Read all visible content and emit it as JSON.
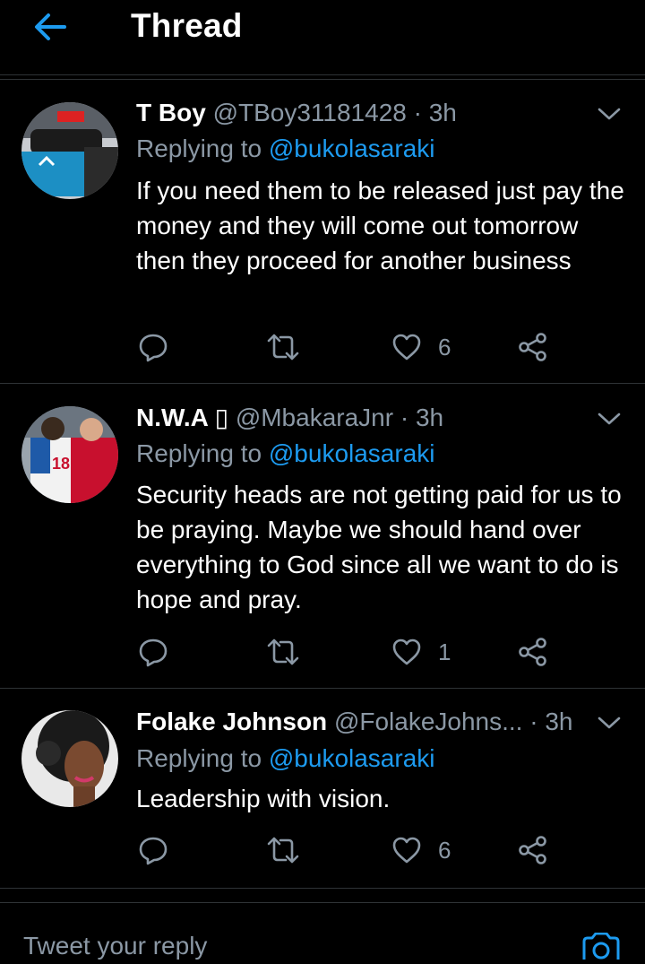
{
  "header": {
    "title": "Thread"
  },
  "tweets": [
    {
      "name": "T Boy",
      "handle": "@TBoy31181428",
      "dot": "·",
      "time": "3h",
      "replying_prefix": "Replying to",
      "replying_to": "@bukolasaraki",
      "text": "If you need them to be released just pay the money and they will come out tomorrow then they proceed for another business",
      "likes": "6"
    },
    {
      "name": "N.W.A ▯",
      "handle": "@MbakaraJnr",
      "dot": "·",
      "time": "3h",
      "replying_prefix": "Replying to",
      "replying_to": "@bukolasaraki",
      "text": "Security heads are not getting paid for us to be praying. Maybe we should hand over everything to God since all we want to do is hope and pray.",
      "likes": "1"
    },
    {
      "name": "Folake Johnson",
      "handle": "@FolakeJohns...",
      "dot": "·",
      "time": "3h",
      "replying_prefix": "Replying to",
      "replying_to": "@bukolasaraki",
      "text": "Leadership with vision.",
      "likes": "6"
    }
  ],
  "composer": {
    "placeholder": "Tweet your reply"
  },
  "colors": {
    "accent": "#1d9bf0",
    "muted": "#8b98a5",
    "divider": "#2f3336",
    "background": "#000000"
  },
  "icons": [
    "back-arrow-icon",
    "chevron-down-icon",
    "reply-icon",
    "retweet-icon",
    "like-icon",
    "share-icon",
    "camera-icon"
  ]
}
